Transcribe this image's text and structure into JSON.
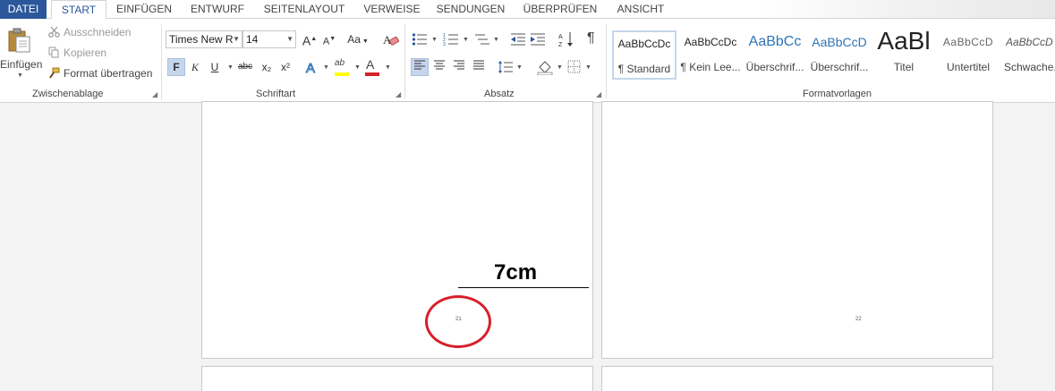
{
  "tabs": [
    "DATEI",
    "START",
    "EINFÜGEN",
    "ENTWURF",
    "SEITENLAYOUT",
    "VERWEISE",
    "SENDUNGEN",
    "ÜBERPRÜFEN",
    "ANSICHT"
  ],
  "clipboard": {
    "paste_label": "Einfügen",
    "cut_label": "Ausschneiden",
    "copy_label": "Kopieren",
    "format_painter_label": "Format übertragen",
    "group_label": "Zwischenablage"
  },
  "font": {
    "font_name": "Times New R",
    "font_size": "14",
    "bold": "F",
    "italic": "K",
    "underline": "U",
    "strikethrough": "abc",
    "subscript": "x₂",
    "superscript": "x²",
    "grow": "A",
    "shrink": "A",
    "case": "Aa",
    "highlight": "ab",
    "color": "A",
    "group_label": "Schriftart"
  },
  "paragraph": {
    "group_label": "Absatz",
    "pilcrow": "¶"
  },
  "styles": {
    "group_label": "Formatvorlagen",
    "items": [
      {
        "sample": "AaBbCcDc",
        "name": "¶ Standard"
      },
      {
        "sample": "AaBbCcDc",
        "name": "¶ Kein Lee..."
      },
      {
        "sample": "AaBbCc",
        "name": "Überschrif..."
      },
      {
        "sample": "AaBbCcD",
        "name": "Überschrif..."
      },
      {
        "sample": "AaBl",
        "name": "Titel"
      },
      {
        "sample": "AaBbCcD",
        "name": "Untertitel"
      },
      {
        "sample": "AaBbCcD",
        "name": "Schwache..."
      }
    ]
  },
  "document": {
    "measure_label": "7cm",
    "page_left_number": "21",
    "page_right_number": "22"
  },
  "colors": {
    "file_tab": "#2b579a",
    "accent": "#2b579a",
    "annotation": "#d7202a",
    "heading_blue": "#2e74b5"
  }
}
